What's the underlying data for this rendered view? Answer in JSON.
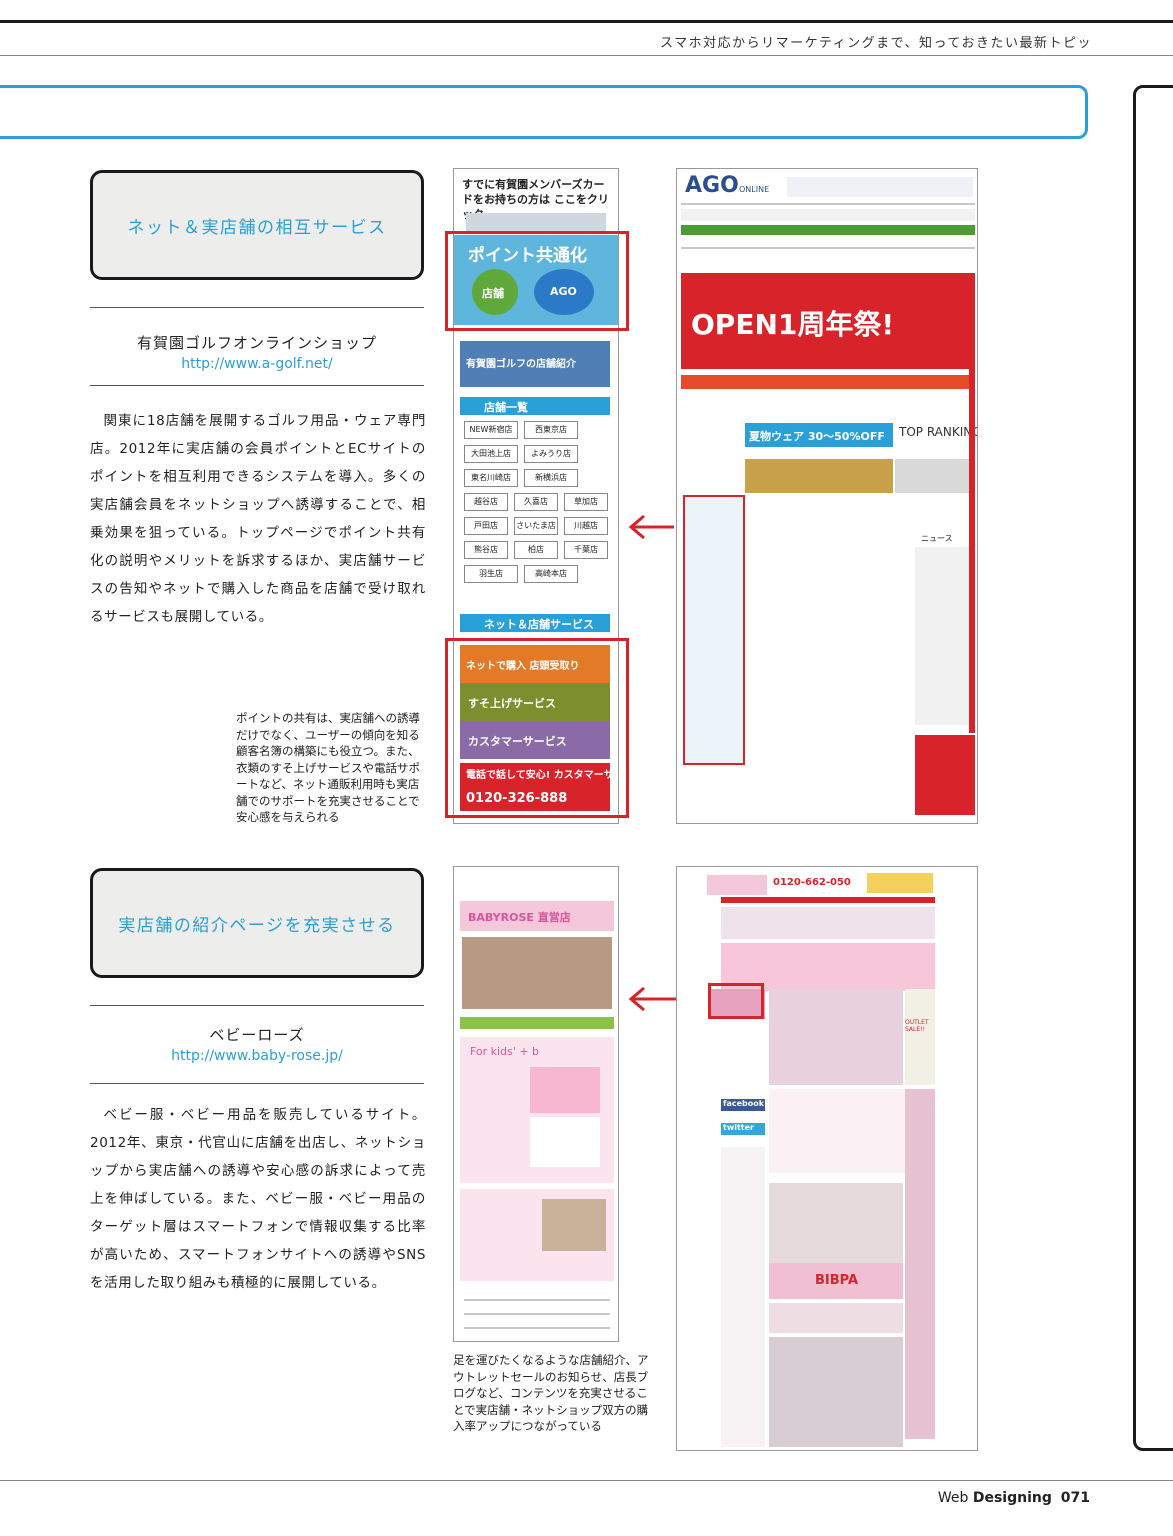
{
  "header": {
    "tagline": "スマホ対応からリマーケティングまで、知っておきたい最新トピック"
  },
  "section1": {
    "label": "ネット＆実店舗の相互サービス",
    "shop_name": "有賀園ゴルフオンラインショップ",
    "url": "http://www.a-golf.net/",
    "body": "関東に18店舗を展開するゴルフ用品・ウェア専門店。2012年に実店舗の会員ポイントとECサイトのポイントを相互利用できるシステムを導入。多くの実店舗会員をネットショップへ誘導することで、相乗効果を狙っている。トップページでポイント共有化の説明やメリットを訴求するほか、実店舗サービスの告知やネットで購入した商品を店舗で受け取れるサービスも展開している。",
    "caption": "ポイントの共有は、実店舗への誘導だけでなく、ユーザーの傾向を知る顧客名簿の構築にも役立つ。また、衣類のすそ上げサービスや電話サポートなど、ネット通販利用時も実店舗でのサポートを充実させることで安心感を与えられる",
    "screenshot": {
      "member_text": "すでに有賀園メンバーズカードをお持ちの方は ここをクリック",
      "point_banner": "ポイント共通化",
      "store_label": "店舗",
      "ago_label": "AGO",
      "store_intro": "有賀園ゴルフの店舗紹介",
      "store_list_title": "店舗一覧",
      "stores": [
        "NEW新宿店",
        "西東京店",
        "大田池上店",
        "よみうり店",
        "東名川崎店",
        "新横浜店",
        "越谷店",
        "久喜店",
        "草加店",
        "戸田店",
        "さいたま店",
        "川越店",
        "熊谷店",
        "柏店",
        "千葉店",
        "羽生店",
        "高崎本店"
      ],
      "service_title": "ネット＆店舗サービス",
      "services": [
        "ネットで購入 店頭受取り",
        "すそ上げサービス",
        "カスタマーサービス"
      ],
      "phone_banner": "電話で話して安心! カスタマーサービス",
      "phone_number": "0120-326-888",
      "site_logo": "AGO",
      "site_logo_sub": "ONLINE",
      "open_banner": "OPEN1周年祭!",
      "sale_text": "夏物ウェア 30〜50%OFF",
      "ranking": "TOP RANKING",
      "news": "ニュース"
    }
  },
  "section2": {
    "label": "実店舗の紹介ページを充実させる",
    "shop_name": "ベビーローズ",
    "url": "http://www.baby-rose.jp/",
    "body": "ベビー服・ベビー用品を販売しているサイト。2012年、東京・代官山に店舗を出店し、ネットショップから実店舗への誘導や安心感の訴求によって売上を伸ばしている。また、ベビー服・ベビー用品のターゲット層はスマートフォンで情報収集する比率が高いため、スマートフォンサイトへの誘導やSNSを活用した取り組みも積極的に展開している。",
    "caption": "足を運びたくなるような店舗紹介、アウトレットセールのお知らせ、店長ブログなど、コンテンツを充実させることで実店舗・ネットショップ双方の購入率アップにつながっている",
    "screenshot": {
      "banner": "BABYROSE 直営店",
      "phone": "0120-662-050",
      "kids_label": "For kids' + b",
      "facebook": "facebook",
      "twitter": "twitter",
      "outlet": "OUTLET SALE!!",
      "bibpa": "BIBPA"
    }
  },
  "footer": {
    "brand_light": "Web ",
    "brand_bold": "Designing",
    "page_number": "071"
  },
  "colors": {
    "accent_blue": "#2aa0d8",
    "highlight_red": "#d8232a",
    "ink": "#1a1a1a"
  }
}
